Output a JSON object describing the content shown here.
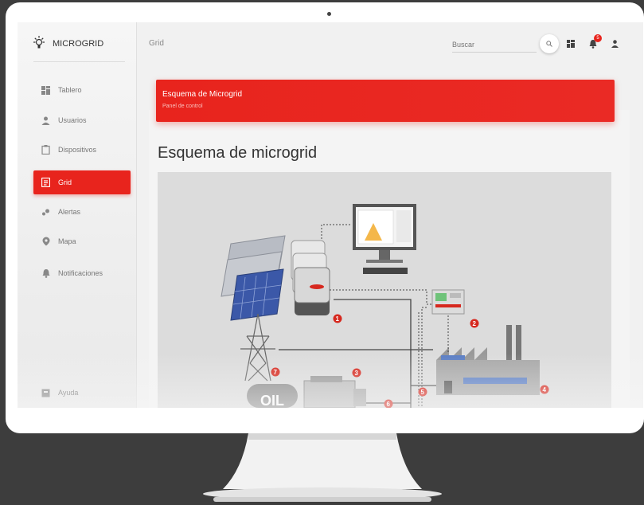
{
  "brand": {
    "name": "MICROGRID",
    "icon": "lightbulb-icon"
  },
  "nav": [
    {
      "label": "Tablero",
      "icon": "dashboard-icon"
    },
    {
      "label": "Usuarios",
      "icon": "user-icon"
    },
    {
      "label": "Dispositivos",
      "icon": "clipboard-icon"
    },
    {
      "label": "Grid",
      "icon": "document-icon",
      "active": true
    },
    {
      "label": "Alertas",
      "icon": "bubbles-icon"
    },
    {
      "label": "Mapa",
      "icon": "pin-icon"
    },
    {
      "label": "Notificaciones",
      "icon": "bell-icon"
    }
  ],
  "help": {
    "label": "Ayuda",
    "icon": "help-icon"
  },
  "header": {
    "crumb": "Grid",
    "search_placeholder": "Buscar",
    "notification_count": "5"
  },
  "card": {
    "title": "Esquema de Microgrid",
    "subtitle": "Panel de control"
  },
  "main": {
    "heading": "Esquema de microgrid"
  },
  "diagram": {
    "oil_label": "OIL",
    "markers": [
      "1",
      "2",
      "3",
      "4",
      "5",
      "6",
      "7"
    ]
  },
  "colors": {
    "accent": "#e8241d",
    "background": "#3d3d3d"
  }
}
